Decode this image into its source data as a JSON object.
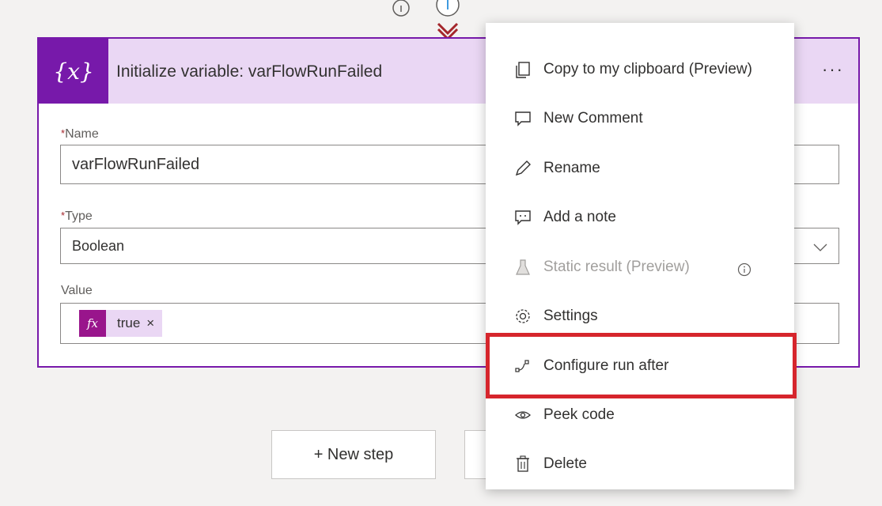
{
  "card": {
    "icon_text": "{x}",
    "title": "Initialize variable: varFlowRunFailed",
    "more_label": "···",
    "required_mark": "*",
    "name_label": "Name",
    "name_value": "varFlowRunFailed",
    "type_label": "Type",
    "type_value": "Boolean",
    "value_label": "Value",
    "token_fx": "fx",
    "token_text": "true",
    "token_remove": "×"
  },
  "buttons": {
    "new_step": "+ New step"
  },
  "menu": {
    "items": [
      {
        "label": "Copy to my clipboard (Preview)",
        "icon": "clipboard-icon"
      },
      {
        "label": "New Comment",
        "icon": "comment-icon"
      },
      {
        "label": "Rename",
        "icon": "pencil-icon"
      },
      {
        "label": "Add a note",
        "icon": "note-icon"
      },
      {
        "label": "Static result (Preview)",
        "icon": "flask-icon",
        "disabled": true
      },
      {
        "label": "Settings",
        "icon": "gear-icon"
      },
      {
        "label": "Configure run after",
        "icon": "run-after-icon",
        "highlighted": true
      },
      {
        "label": "Peek code",
        "icon": "eye-icon"
      },
      {
        "label": "Delete",
        "icon": "trash-icon"
      }
    ]
  },
  "colors": {
    "accent": "#7719aa",
    "header_bg": "#ead7f4",
    "highlight": "#d6252c",
    "token_fx": "#99158c"
  }
}
